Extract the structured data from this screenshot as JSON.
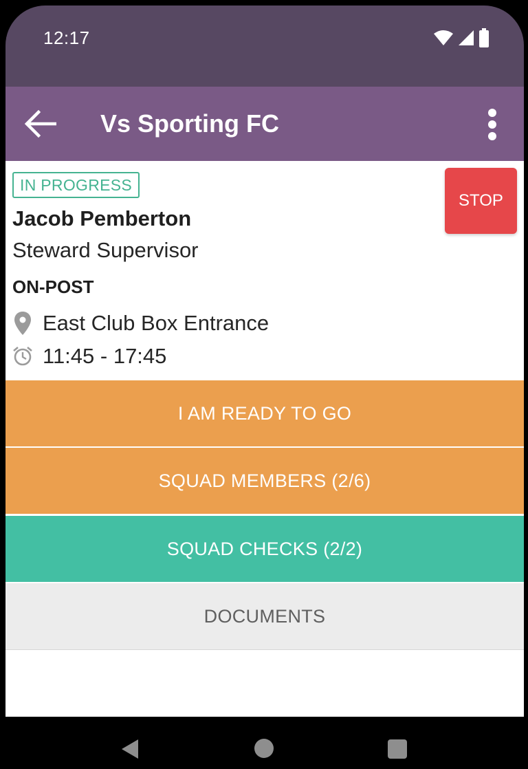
{
  "status_bar": {
    "time": "12:17"
  },
  "app_bar": {
    "title": "Vs Sporting FC",
    "back_icon": "arrow-back-icon",
    "menu_icon": "more-vert-icon"
  },
  "assignment": {
    "status_badge": "IN PROGRESS",
    "stop_label": "STOP",
    "name": "Jacob Pemberton",
    "role": "Steward Supervisor",
    "post_status": "ON-POST",
    "location": "East Club Box Entrance",
    "time_range": "11:45 - 17:45",
    "location_icon": "location-pin-icon",
    "time_icon": "alarm-clock-icon"
  },
  "actions": {
    "ready": "I AM READY TO GO",
    "squad_members": "SQUAD MEMBERS (2/6)",
    "squad_checks": "SQUAD CHECKS (2/2)",
    "documents": "DOCUMENTS"
  },
  "colors": {
    "status_bar": "#574862",
    "app_bar": "#7a5a86",
    "badge": "#45b391",
    "stop": "#e6474a",
    "orange_action": "#eb9f4e",
    "teal_action": "#43bfa3",
    "documents_bg": "#ececec"
  }
}
